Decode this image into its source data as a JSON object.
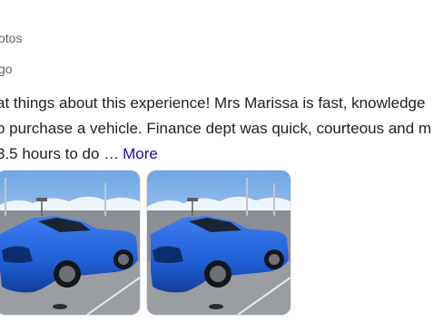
{
  "review": {
    "photos_label": "otos",
    "time_ago": "go",
    "lines": [
      "at things about this experience! Mrs Marissa is fast, knowledge",
      "o purchase a vehicle. Finance dept was quick, courteous and m",
      "3.5 hours to do …"
    ],
    "more_label": "More"
  },
  "photos": [
    {
      "alt": "Blue sports coupe parked in dealership lot"
    },
    {
      "alt": "Blue sports coupe parked in dealership lot"
    }
  ],
  "colors": {
    "link": "#1a0dab",
    "car_blue": "#1f5fd6",
    "sky": "#9fc4ee"
  }
}
